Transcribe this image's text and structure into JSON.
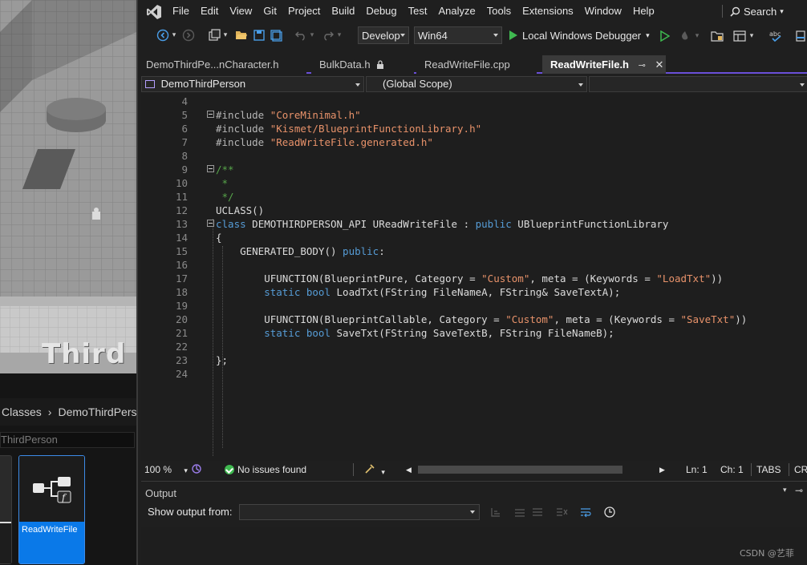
{
  "unreal": {
    "viewport_overlay_text": "Third",
    "breadcrumb": [
      "Classes",
      "DemoThirdPerson"
    ],
    "path_field": "ThirdPerson",
    "asset_label": "ReadWriteFile"
  },
  "menubar": {
    "items": [
      "File",
      "Edit",
      "View",
      "Git",
      "Project",
      "Build",
      "Debug",
      "Test",
      "Analyze",
      "Tools",
      "Extensions",
      "Window",
      "Help"
    ],
    "search_label": "Search"
  },
  "toolbar": {
    "configuration": "Develop",
    "platform": "Win64",
    "debugger_label": "Local Windows Debugger"
  },
  "tabs": [
    {
      "label": "DemoThirdPe...nCharacter.h",
      "active": false
    },
    {
      "label": "BulkData.h",
      "active": false,
      "locked": true
    },
    {
      "label": "ReadWriteFile.cpp",
      "active": false
    },
    {
      "label": "ReadWriteFile.h",
      "active": true
    }
  ],
  "navbar": {
    "project": "DemoThirdPerson",
    "scope": "(Global Scope)"
  },
  "code": {
    "lines": [
      {
        "n": "4",
        "tokens": []
      },
      {
        "n": "5",
        "tokens": [
          [
            "pp",
            "#include "
          ],
          [
            "str",
            "\"CoreMinimal.h\""
          ]
        ]
      },
      {
        "n": "6",
        "tokens": [
          [
            "pp",
            "#include "
          ],
          [
            "str",
            "\"Kismet/BlueprintFunctionLibrary.h\""
          ]
        ]
      },
      {
        "n": "7",
        "tokens": [
          [
            "pp",
            "#include "
          ],
          [
            "str",
            "\"ReadWriteFile.generated.h\""
          ]
        ]
      },
      {
        "n": "8",
        "tokens": []
      },
      {
        "n": "9",
        "tokens": [
          [
            "cm",
            "/**"
          ]
        ]
      },
      {
        "n": "10",
        "tokens": [
          [
            "cm",
            " *"
          ]
        ]
      },
      {
        "n": "11",
        "tokens": [
          [
            "cm",
            " */"
          ]
        ]
      },
      {
        "n": "12",
        "tokens": [
          [
            "id",
            "UCLASS()"
          ]
        ]
      },
      {
        "n": "13",
        "tokens": [
          [
            "kw",
            "class"
          ],
          [
            "id",
            " DEMOTHIRDPERSON_API UReadWriteFile : "
          ],
          [
            "kw",
            "public"
          ],
          [
            "id",
            " UBlueprintFunctionLibrary"
          ]
        ]
      },
      {
        "n": "14",
        "tokens": [
          [
            "id",
            "{"
          ]
        ]
      },
      {
        "n": "15",
        "tokens": [
          [
            "id",
            "    GENERATED_BODY() "
          ],
          [
            "kw",
            "public"
          ],
          [
            "id",
            ":"
          ]
        ]
      },
      {
        "n": "16",
        "tokens": []
      },
      {
        "n": "17",
        "tokens": [
          [
            "id",
            "        UFUNCTION(BlueprintPure, Category = "
          ],
          [
            "str",
            "\"Custom\""
          ],
          [
            "id",
            ", meta = (Keywords = "
          ],
          [
            "str",
            "\"LoadTxt\""
          ],
          [
            "id",
            "))"
          ]
        ]
      },
      {
        "n": "18",
        "tokens": [
          [
            "kw",
            "        static bool"
          ],
          [
            "id",
            " LoadTxt(FString FileNameA, FString& SaveTextA);"
          ]
        ]
      },
      {
        "n": "19",
        "tokens": []
      },
      {
        "n": "20",
        "tokens": [
          [
            "id",
            "        UFUNCTION(BlueprintCallable, Category = "
          ],
          [
            "str",
            "\"Custom\""
          ],
          [
            "id",
            ", meta = (Keywords = "
          ],
          [
            "str",
            "\"SaveTxt\""
          ],
          [
            "id",
            "))"
          ]
        ]
      },
      {
        "n": "21",
        "tokens": [
          [
            "kw",
            "        static bool"
          ],
          [
            "id",
            " SaveTxt(FString SaveTextB, FString FileNameB);"
          ]
        ]
      },
      {
        "n": "22",
        "tokens": []
      },
      {
        "n": "23",
        "tokens": [
          [
            "id",
            "};"
          ]
        ]
      },
      {
        "n": "24",
        "tokens": []
      }
    ]
  },
  "status": {
    "zoom": "100 %",
    "issues": "No issues found",
    "line": "Ln: 1",
    "col": "Ch: 1",
    "indent": "TABS",
    "eol": "CR"
  },
  "output": {
    "title": "Output",
    "show_from_label": "Show output from:",
    "show_from_value": ""
  },
  "watermark": "CSDN @艺菲",
  "colors": {
    "accent": "#6a4fd8",
    "selection": "#0a79e8",
    "run_green": "#3fb950",
    "string": "#e8926a",
    "keyword": "#569cd6",
    "comment": "#57a64a"
  }
}
